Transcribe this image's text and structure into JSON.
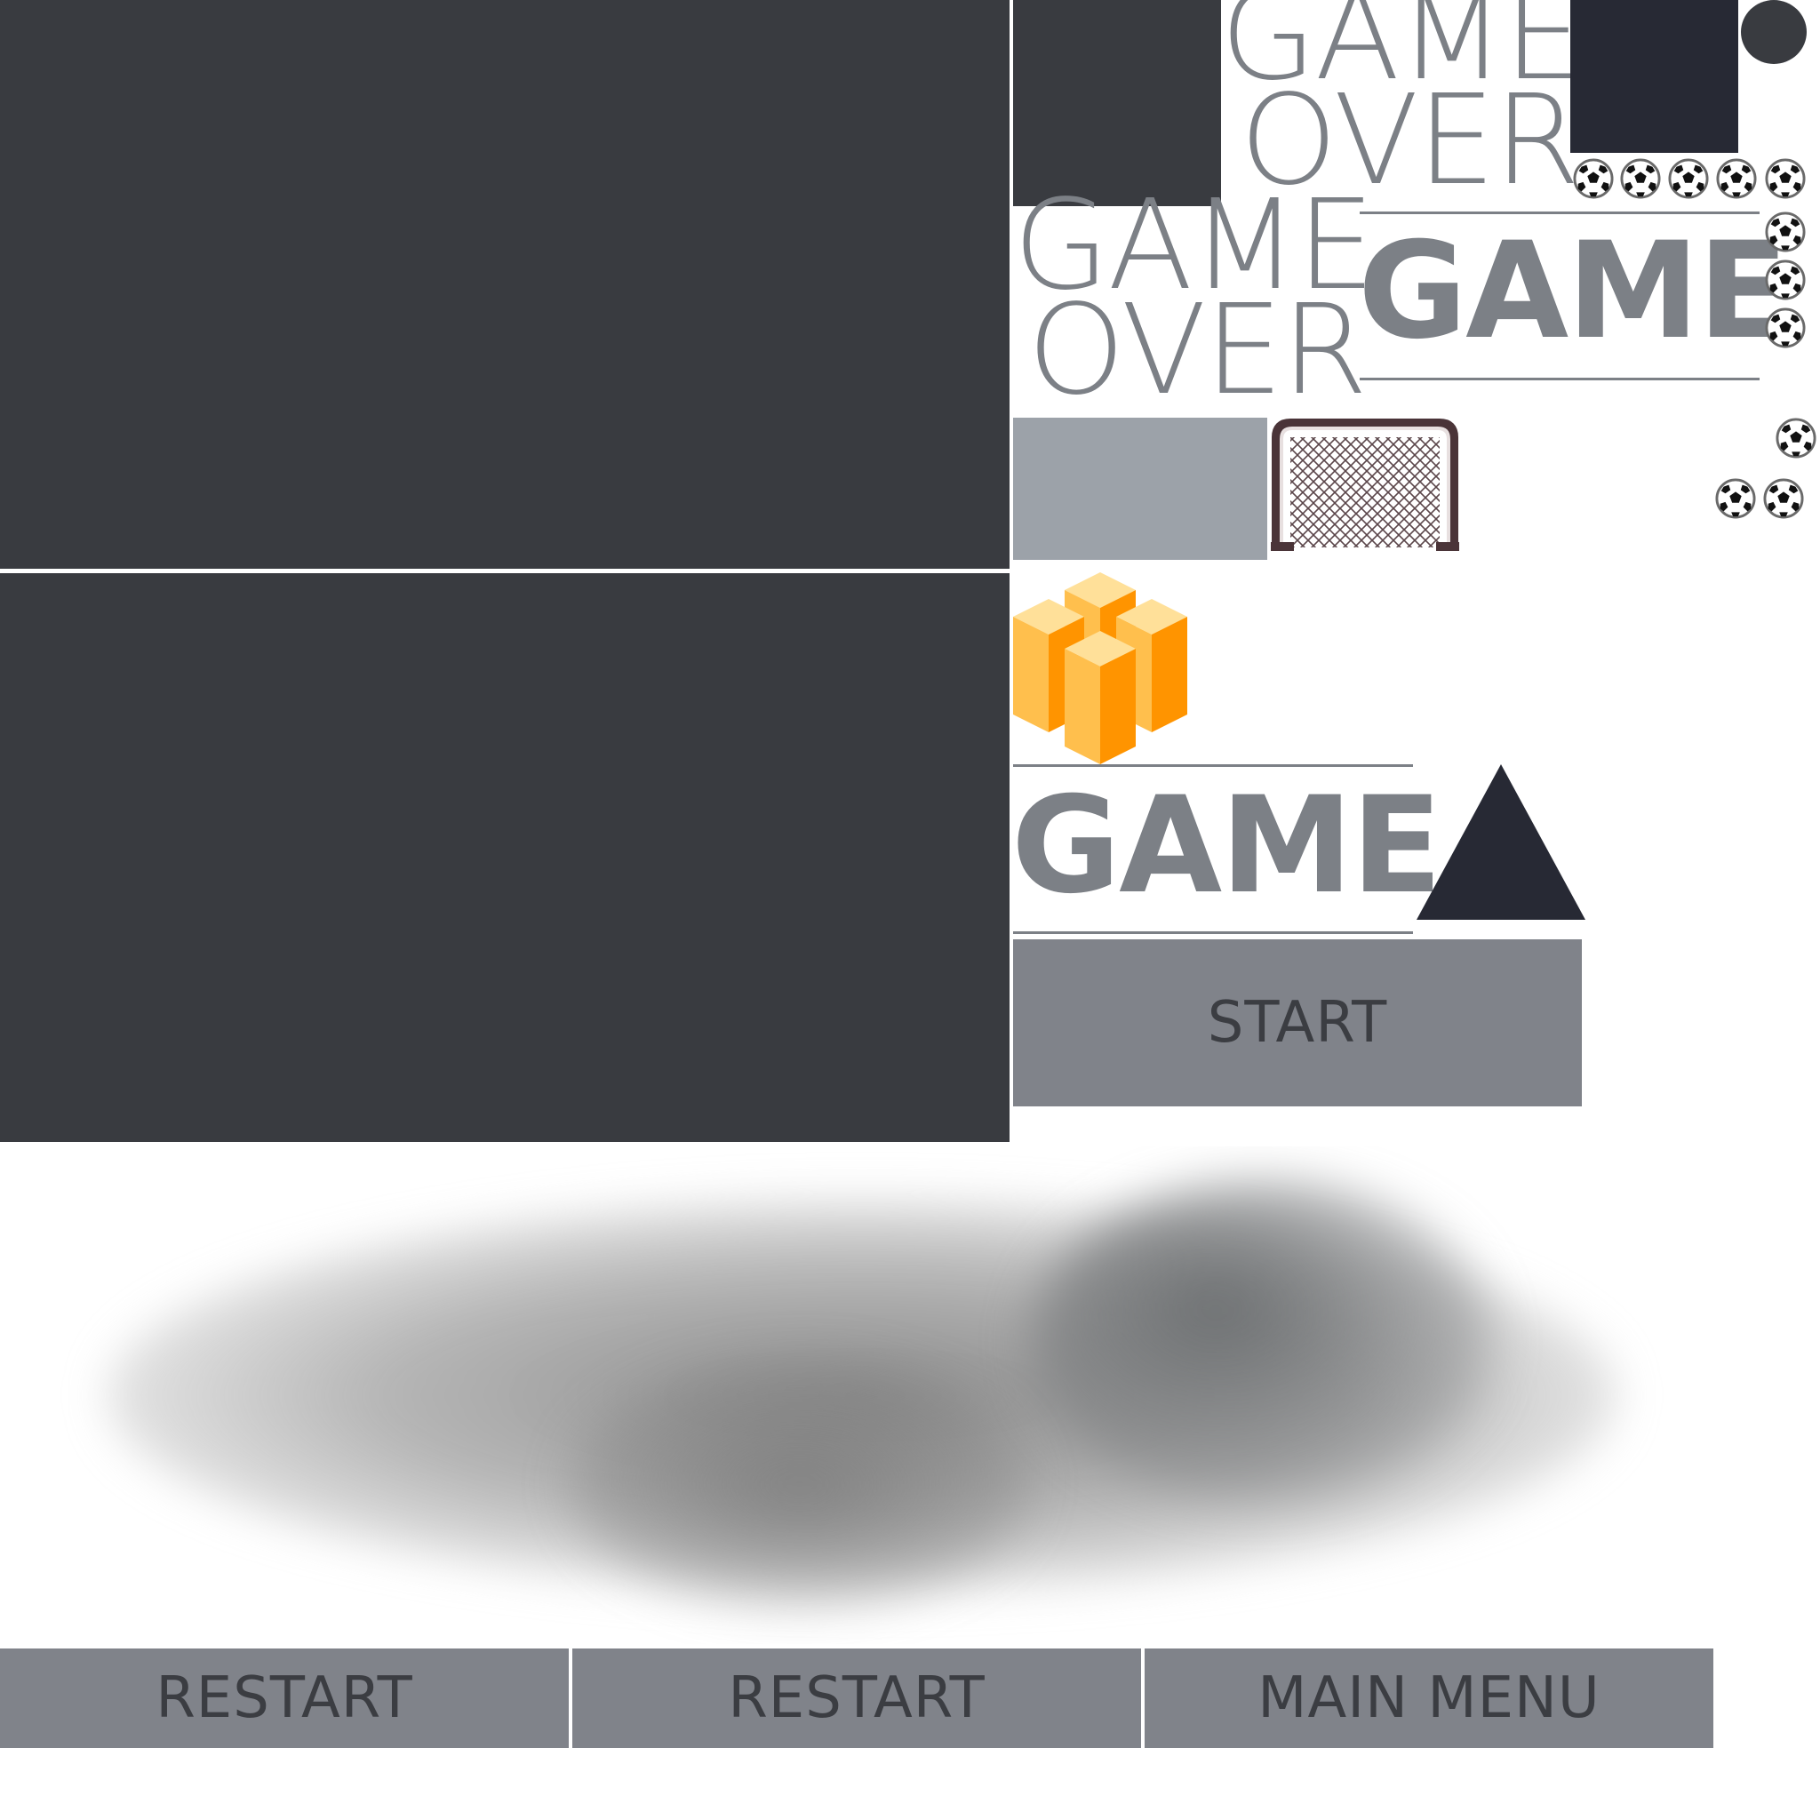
{
  "texts": {
    "game_over_top_line1": "GAME",
    "game_over_top_line2": "OVER",
    "game_over_mid_line1": "GAME",
    "game_over_mid_line2": "OVER",
    "game_bold_top": "GAME",
    "game_bold_mid": "GAME"
  },
  "buttons": {
    "start": "START",
    "restart_1": "RESTART",
    "restart_2": "RESTART",
    "main_menu": "MAIN MENU"
  },
  "colors": {
    "dark_panel": "#393b40",
    "darker_square": "#272934",
    "light_grey_block": "#9ca2a9",
    "button_grey": "#80838a",
    "text_grey": "#7c8086",
    "logo_orange": "#ff9400",
    "logo_yellow": "#ffbf4d"
  },
  "icons": {
    "soccer_ball": "soccer-ball-icon",
    "goal_net": "goal-net-icon",
    "triangle": "triangle-icon",
    "circle": "circle-icon",
    "logo": "cube-logo-icon"
  }
}
